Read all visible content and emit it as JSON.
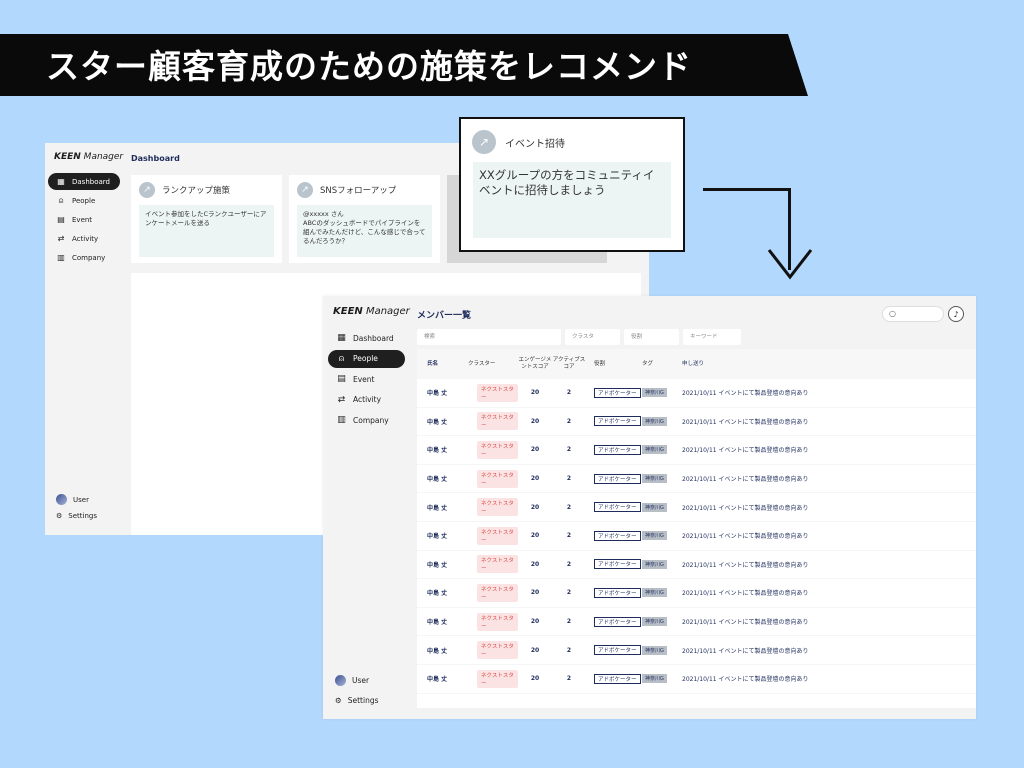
{
  "banner": {
    "title": "スター顧客育成のための施策をレコメンド"
  },
  "back_window": {
    "logo_keen": "KEEN",
    "logo_manager": " Manager",
    "page_title": "Dashboard",
    "nav": [
      {
        "label": "Dashboard",
        "icon": "grid-icon"
      },
      {
        "label": "People",
        "icon": "person-icon"
      },
      {
        "label": "Event",
        "icon": "calendar-icon"
      },
      {
        "label": "Activity",
        "icon": "arrows-icon"
      },
      {
        "label": "Company",
        "icon": "building-icon"
      }
    ],
    "footer": {
      "user": "User",
      "settings": "Settings"
    },
    "cards": [
      {
        "title": "ランクアップ施策",
        "body": "イベント参加をしたCランクユーザーにアンケートメールを送る"
      },
      {
        "title": "SNSフォローアップ",
        "body": "@xxxxx さん\nABCのダッシュボードでパイプラインを組んでみたんだけど、こんな感じで合ってるんだろうか？"
      }
    ]
  },
  "popup": {
    "title": "イベント招待",
    "body": "XXグループの方をコミュニティイベントに招待しましょう"
  },
  "front_window": {
    "logo_keen": "KEEN",
    "logo_manager": " Manager",
    "page_title": "メンバー一覧",
    "nav": [
      {
        "label": "Dashboard",
        "icon": "grid-icon"
      },
      {
        "label": "People",
        "icon": "person-icon"
      },
      {
        "label": "Event",
        "icon": "calendar-icon"
      },
      {
        "label": "Activity",
        "icon": "arrows-icon"
      },
      {
        "label": "Company",
        "icon": "building-icon"
      }
    ],
    "footer": {
      "user": "User",
      "settings": "Settings"
    },
    "filters": [
      "検索",
      "クラスタ",
      "役割",
      "キーワード"
    ],
    "columns": {
      "name": "氏名",
      "cluster": "クラスター",
      "engagement": "エンゲージメントスコア",
      "activity": "アクティブスコア",
      "role": "役割",
      "tag": "タグ",
      "note": "申し送り"
    },
    "rows": [
      {
        "name": "中島 丈",
        "cluster": "ネクストスター",
        "engagement": "20",
        "activity": "2",
        "role": "アドボケーター",
        "tag": "神奈川G",
        "note": "2021/10/11 イベントにて製品登壇の意向あり"
      },
      {
        "name": "中島 丈",
        "cluster": "ネクストスター",
        "engagement": "20",
        "activity": "2",
        "role": "アドボケーター",
        "tag": "神奈川G",
        "note": "2021/10/11 イベントにて製品登壇の意向あり"
      },
      {
        "name": "中島 丈",
        "cluster": "ネクストスター",
        "engagement": "20",
        "activity": "2",
        "role": "アドボケーター",
        "tag": "神奈川G",
        "note": "2021/10/11 イベントにて製品登壇の意向あり"
      },
      {
        "name": "中島 丈",
        "cluster": "ネクストスター",
        "engagement": "20",
        "activity": "2",
        "role": "アドボケーター",
        "tag": "神奈川G",
        "note": "2021/10/11 イベントにて製品登壇の意向あり"
      },
      {
        "name": "中島 丈",
        "cluster": "ネクストスター",
        "engagement": "20",
        "activity": "2",
        "role": "アドボケーター",
        "tag": "神奈川G",
        "note": "2021/10/11 イベントにて製品登壇の意向あり"
      },
      {
        "name": "中島 丈",
        "cluster": "ネクストスター",
        "engagement": "20",
        "activity": "2",
        "role": "アドボケーター",
        "tag": "神奈川G",
        "note": "2021/10/11 イベントにて製品登壇の意向あり"
      },
      {
        "name": "中島 丈",
        "cluster": "ネクストスター",
        "engagement": "20",
        "activity": "2",
        "role": "アドボケーター",
        "tag": "神奈川G",
        "note": "2021/10/11 イベントにて製品登壇の意向あり"
      },
      {
        "name": "中島 丈",
        "cluster": "ネクストスター",
        "engagement": "20",
        "activity": "2",
        "role": "アドボケーター",
        "tag": "神奈川G",
        "note": "2021/10/11 イベントにて製品登壇の意向あり"
      },
      {
        "name": "中島 丈",
        "cluster": "ネクストスター",
        "engagement": "20",
        "activity": "2",
        "role": "アドボケーター",
        "tag": "神奈川G",
        "note": "2021/10/11 イベントにて製品登壇の意向あり"
      },
      {
        "name": "中島 丈",
        "cluster": "ネクストスター",
        "engagement": "20",
        "activity": "2",
        "role": "アドボケーター",
        "tag": "神奈川G",
        "note": "2021/10/11 イベントにて製品登壇の意向あり"
      },
      {
        "name": "中島 丈",
        "cluster": "ネクストスター",
        "engagement": "20",
        "activity": "2",
        "role": "アドボケーター",
        "tag": "神奈川G",
        "note": "2021/10/11 イベントにて製品登壇の意向あり"
      }
    ]
  }
}
